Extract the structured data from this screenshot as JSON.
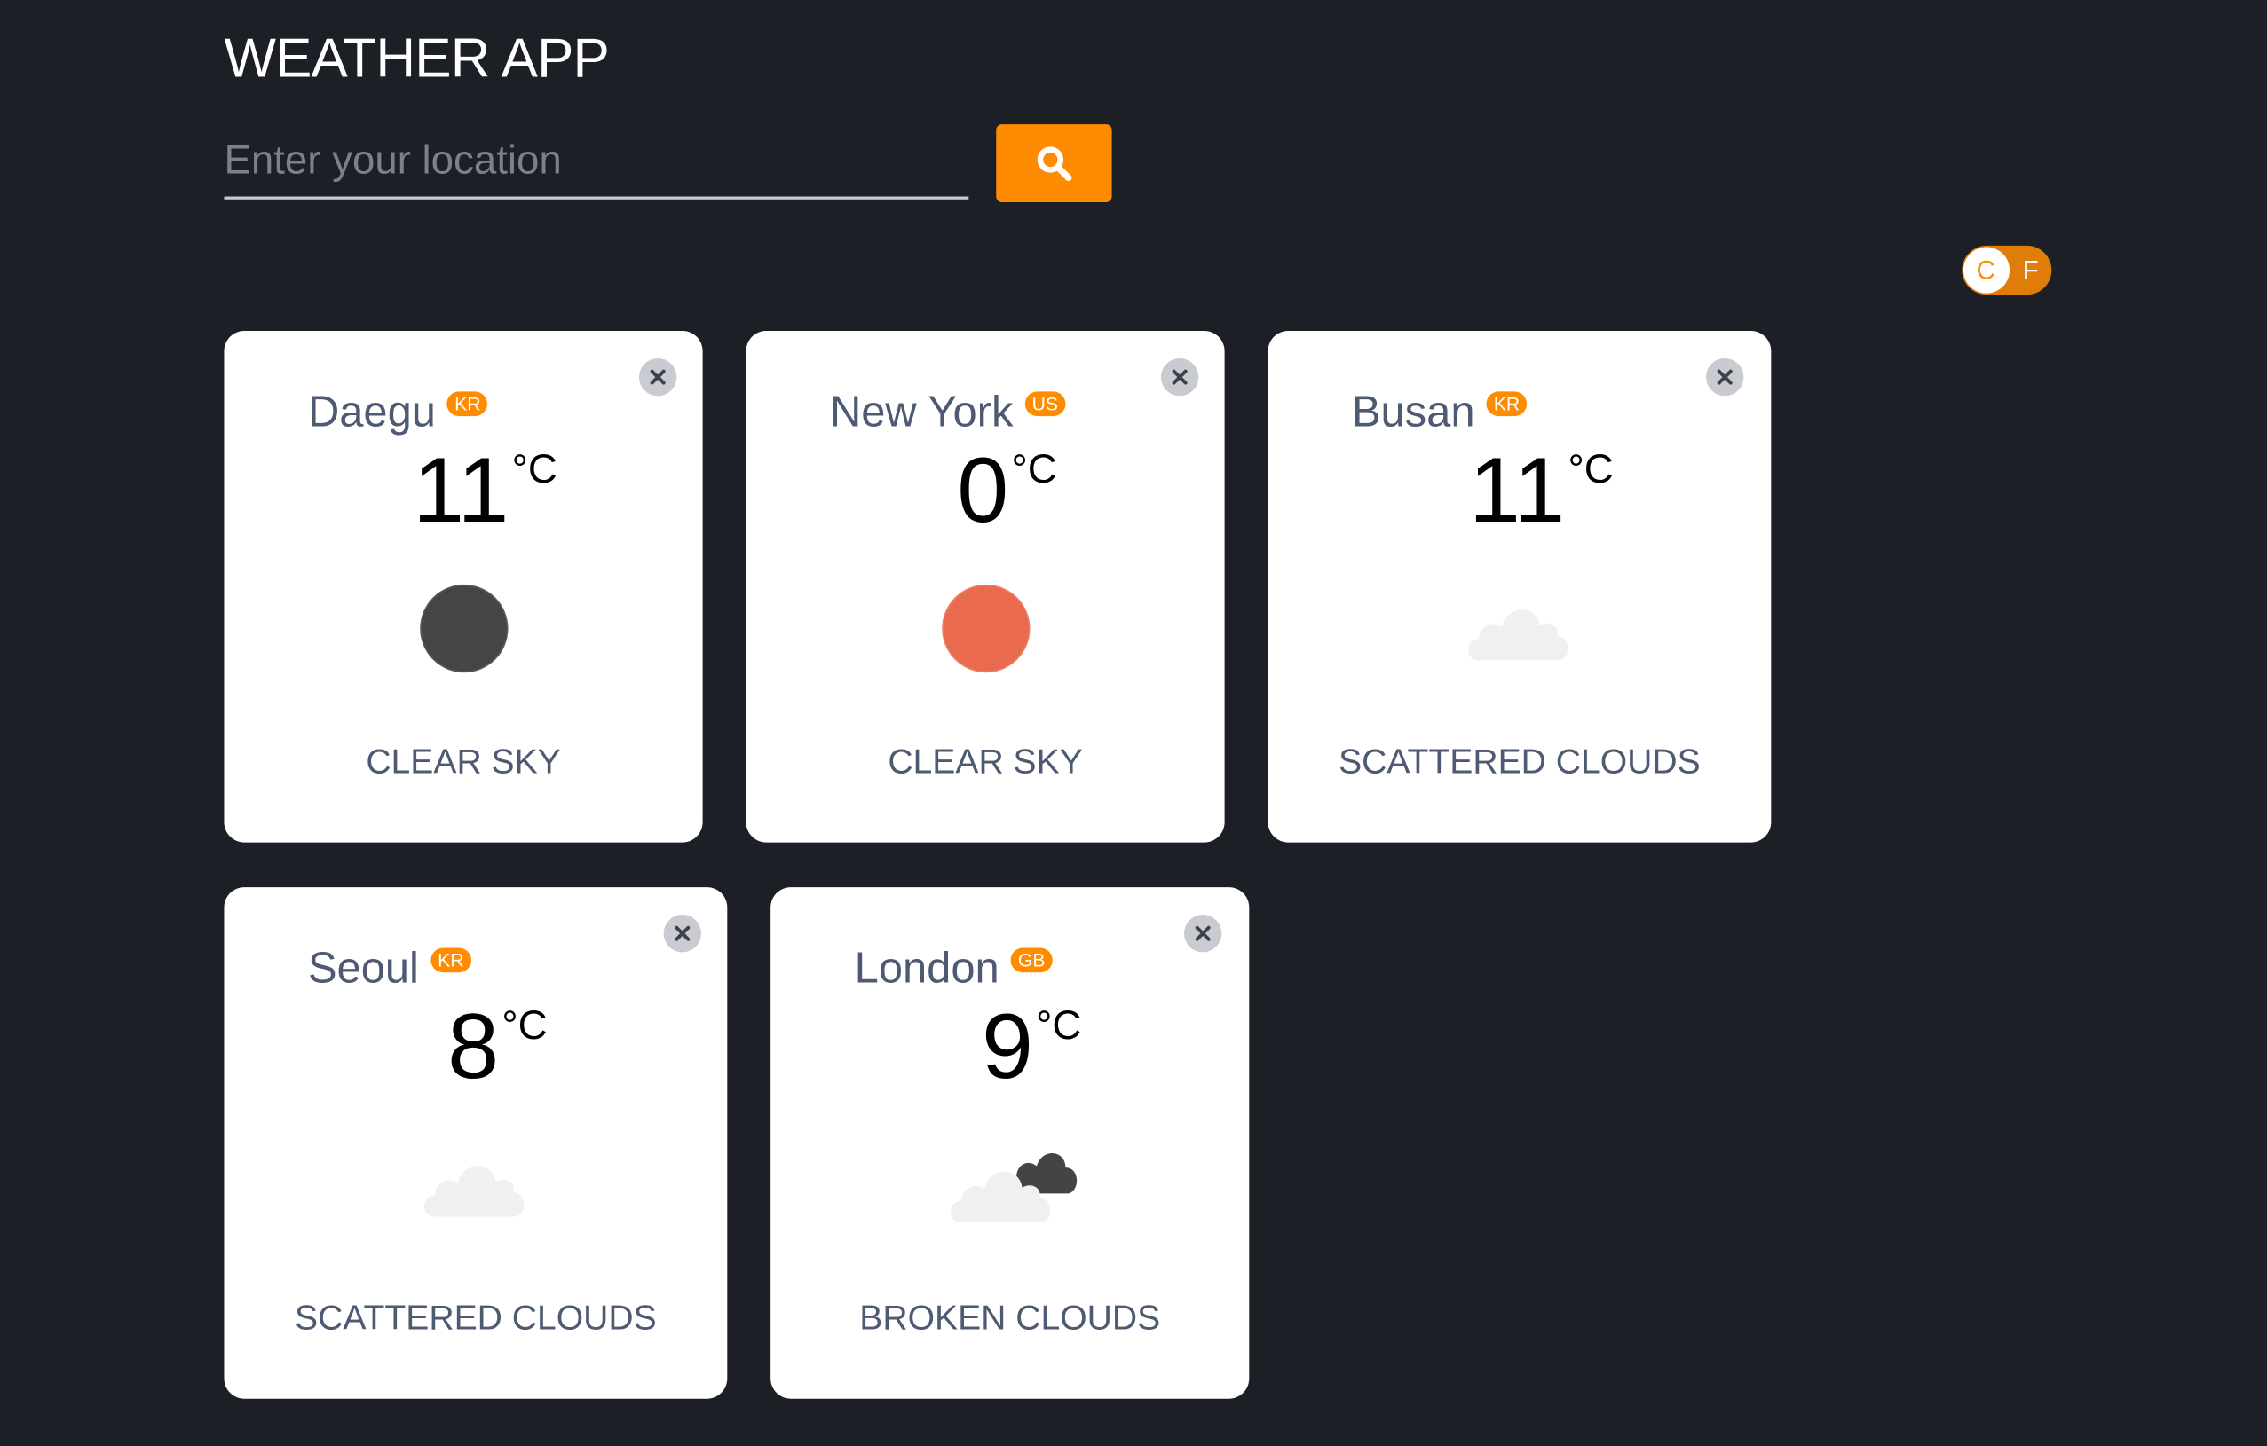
{
  "app": {
    "title": "WEATHER APP"
  },
  "search": {
    "placeholder": "Enter your location",
    "value": ""
  },
  "unit_toggle": {
    "celsius_label": "C",
    "fahrenheit_label": "F",
    "selected": "C"
  },
  "colors": {
    "background": "#1d1f26",
    "accent": "#ff8c00",
    "card": "#ffffff",
    "label": "#4e5a72"
  },
  "cards": [
    {
      "city": "Daegu",
      "country": "KR",
      "temp": "11",
      "unit": "°C",
      "icon": "clear-sky-night-icon",
      "description": "CLEAR SKY"
    },
    {
      "city": "New York",
      "country": "US",
      "temp": "0",
      "unit": "°C",
      "icon": "clear-sky-day-icon",
      "description": "CLEAR SKY"
    },
    {
      "city": "Busan",
      "country": "KR",
      "temp": "11",
      "unit": "°C",
      "icon": "scattered-clouds-icon",
      "description": "SCATTERED CLOUDS"
    },
    {
      "city": "Seoul",
      "country": "KR",
      "temp": "8",
      "unit": "°C",
      "icon": "scattered-clouds-icon",
      "description": "SCATTERED CLOUDS"
    },
    {
      "city": "London",
      "country": "GB",
      "temp": "9",
      "unit": "°C",
      "icon": "broken-clouds-icon",
      "description": "BROKEN CLOUDS"
    }
  ]
}
